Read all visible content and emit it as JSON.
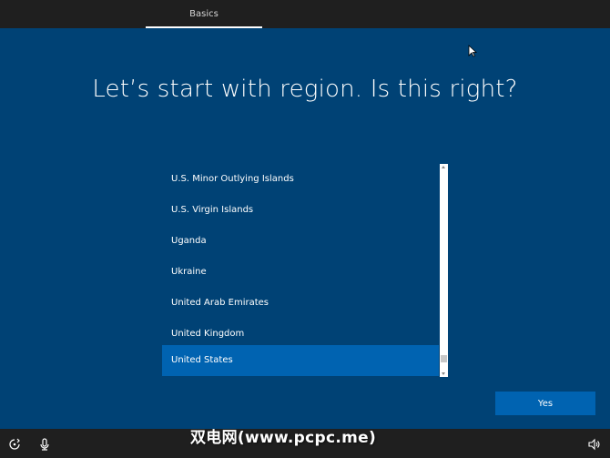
{
  "header": {
    "tab_label": "Basics"
  },
  "main": {
    "title": "Let’s start with region. Is this right?",
    "regions": [
      {
        "label": "U.S. Minor Outlying Islands",
        "selected": false
      },
      {
        "label": "U.S. Virgin Islands",
        "selected": false
      },
      {
        "label": "Uganda",
        "selected": false
      },
      {
        "label": "Ukraine",
        "selected": false
      },
      {
        "label": "United Arab Emirates",
        "selected": false
      },
      {
        "label": "United Kingdom",
        "selected": false
      },
      {
        "label": "United States",
        "selected": true
      }
    ],
    "confirm_button": "Yes"
  },
  "footer": {
    "icons": [
      "ease-of-access-icon",
      "microphone-icon",
      "volume-icon"
    ],
    "watermark": "双电网(www.pcpc.me)"
  },
  "colors": {
    "background": "#004275",
    "selected": "#0063b1",
    "button": "#0063b1",
    "bars": "#1f1f1f"
  }
}
